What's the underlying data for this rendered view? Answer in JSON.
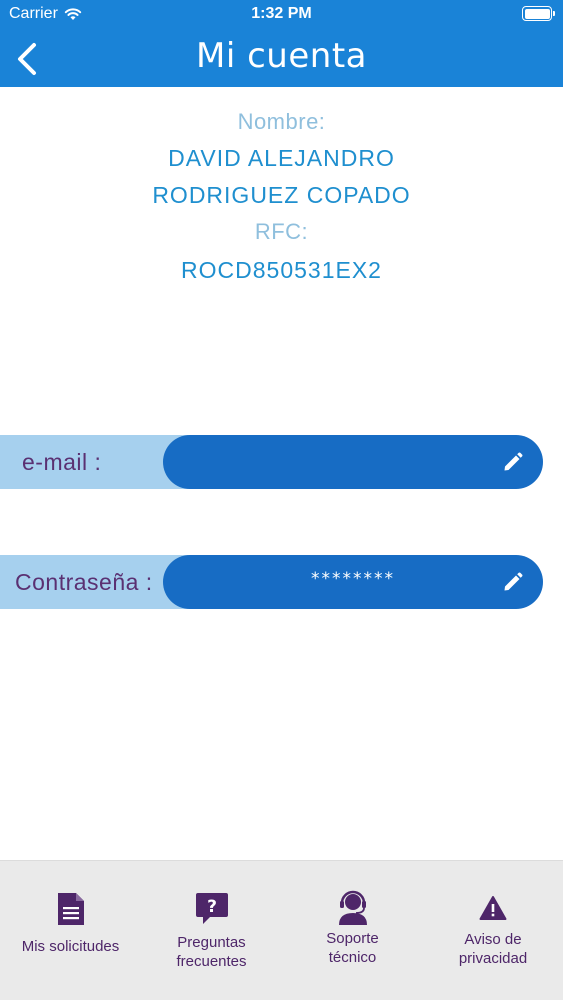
{
  "status_bar": {
    "carrier": "Carrier",
    "time": "1:32 PM"
  },
  "nav": {
    "title": "Mi cuenta",
    "back_icon": "chevron-left-icon"
  },
  "profile": {
    "name_label": "Nombre:",
    "name_line1": "DAVID ALEJANDRO",
    "name_line2": "RODRIGUEZ COPADO",
    "rfc_label": "RFC:",
    "rfc_value": "ROCD850531EX2"
  },
  "fields": {
    "email": {
      "label": "e-mail :",
      "value": "",
      "edit_icon": "pencil-icon"
    },
    "password": {
      "label": "Contraseña :",
      "value": "********",
      "edit_icon": "pencil-icon"
    }
  },
  "tabbar": {
    "items": [
      {
        "label_line1": "Mis solicitudes",
        "label_line2": "",
        "icon": "document-icon"
      },
      {
        "label_line1": "Preguntas",
        "label_line2": "frecuentes",
        "icon": "question-bubble-icon"
      },
      {
        "label_line1": "Soporte",
        "label_line2": "técnico",
        "icon": "headset-icon"
      },
      {
        "label_line1": "Aviso de",
        "label_line2": "privacidad",
        "icon": "warning-icon"
      }
    ]
  },
  "colors": {
    "header": "#1a83d7",
    "pill": "#176cc4",
    "band": "#a6d0ee",
    "label_text": "#5a3072",
    "tab_text": "#4e2669",
    "value_text": "#1f8fcf",
    "muted_text": "#8fbfdd"
  }
}
